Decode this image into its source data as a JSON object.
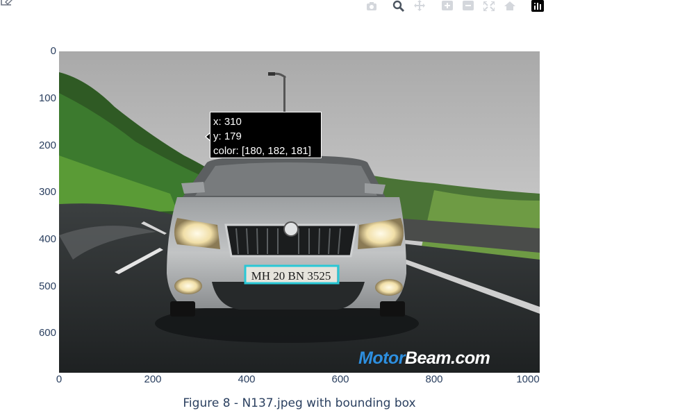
{
  "figure": {
    "caption": "Figure 8 - N137.jpeg with bounding box"
  },
  "modebar": {
    "buttons": [
      {
        "name": "camera-icon",
        "title": "Download plot as a png"
      },
      {
        "name": "zoom-icon",
        "title": "Zoom"
      },
      {
        "name": "pan-icon",
        "title": "Pan"
      },
      {
        "name": "zoom-in-icon",
        "title": "Zoom in"
      },
      {
        "name": "zoom-out-icon",
        "title": "Zoom out"
      },
      {
        "name": "autoscale-icon",
        "title": "Autoscale"
      },
      {
        "name": "home-icon",
        "title": "Reset axes"
      },
      {
        "name": "plotly-logo-icon",
        "title": "Produced with Plotly"
      }
    ]
  },
  "axes": {
    "x_ticks": [
      "0",
      "200",
      "400",
      "600",
      "800",
      "1000"
    ],
    "y_ticks": [
      "0",
      "100",
      "200",
      "300",
      "400",
      "500",
      "600"
    ],
    "x_range": [
      0,
      1023
    ],
    "y_range": [
      684,
      0
    ]
  },
  "hover": {
    "x_line": "x: 310",
    "y_line": "y: 179",
    "color_line": "color: [180, 182, 181]"
  },
  "image": {
    "plate_text": "MH 20 BN 3525",
    "watermark_a": "Motor",
    "watermark_b": "Beam.com",
    "bounding_box": {
      "x0": 396,
      "y0": 456,
      "x1": 594,
      "y1": 493,
      "color": "#29c8d6"
    }
  }
}
